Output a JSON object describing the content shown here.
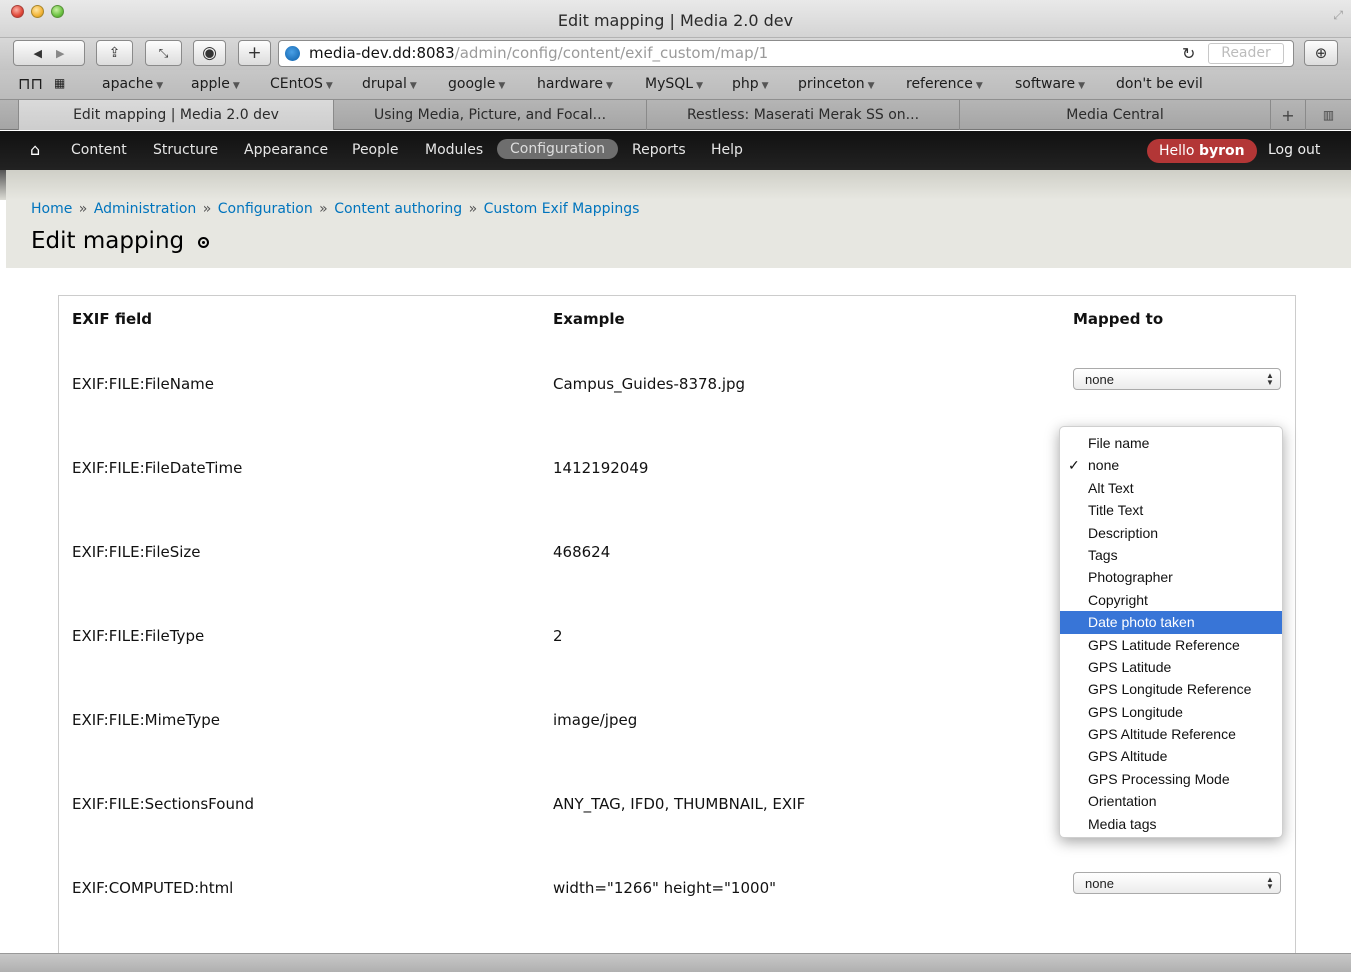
{
  "window": {
    "title": "Edit mapping | Media 2.0 dev"
  },
  "toolbar": {
    "url_host": "media-dev.dd:8083",
    "url_path": "/admin/config/content/exif_custom/map/1",
    "reader_label": "Reader"
  },
  "bookmarks": [
    "apache",
    "apple",
    "CEntOS",
    "drupal",
    "google",
    "hardware",
    "MySQL",
    "php",
    "princeton",
    "reference",
    "software",
    "don't be evil"
  ],
  "tabs": [
    "Edit mapping | Media 2.0 dev",
    "Using Media, Picture, and Focal...",
    "Restless: Maserati Merak SS on...",
    "Media Central"
  ],
  "admin_menu": {
    "items": [
      "Content",
      "Structure",
      "Appearance",
      "People",
      "Modules",
      "Configuration",
      "Reports",
      "Help"
    ],
    "active": "Configuration",
    "greeting": "Hello",
    "username": "byron",
    "logout": "Log out"
  },
  "breadcrumb": [
    "Home",
    "Administration",
    "Configuration",
    "Content authoring",
    "Custom Exif Mappings"
  ],
  "breadcrumb_sep": "»",
  "page_title": "Edit mapping",
  "table": {
    "headers": [
      "EXIF field",
      "Example",
      "Mapped to"
    ],
    "rows": [
      {
        "field": "EXIF:FILE:FileName",
        "example": "Campus_Guides-8378.jpg",
        "mapped": "none"
      },
      {
        "field": "EXIF:FILE:FileDateTime",
        "example": "1412192049",
        "mapped": "none"
      },
      {
        "field": "EXIF:FILE:FileSize",
        "example": "468624",
        "mapped": "none"
      },
      {
        "field": "EXIF:FILE:FileType",
        "example": "2",
        "mapped": "none"
      },
      {
        "field": "EXIF:FILE:MimeType",
        "example": "image/jpeg",
        "mapped": "none"
      },
      {
        "field": "EXIF:FILE:SectionsFound",
        "example": "ANY_TAG, IFD0, THUMBNAIL, EXIF",
        "mapped": "none"
      },
      {
        "field": "EXIF:COMPUTED:html",
        "example": "width=\"1266\" height=\"1000\"",
        "mapped": "none"
      }
    ]
  },
  "dropdown": {
    "options": [
      "File name",
      "none",
      "Alt Text",
      "Title Text",
      "Description",
      "Tags",
      "Photographer",
      "Copyright",
      "Date photo taken",
      "GPS Latitude Reference",
      "GPS Latitude",
      "GPS Longitude Reference",
      "GPS Longitude",
      "GPS Altitude Reference",
      "GPS Altitude",
      "GPS Processing Mode",
      "Orientation",
      "Media tags"
    ],
    "checked": "none",
    "highlighted": "Date photo taken"
  },
  "colors": {
    "link": "#0074bd",
    "highlight": "#3875d7",
    "hello_badge": "#b33636",
    "admin_bar": "#111111"
  }
}
